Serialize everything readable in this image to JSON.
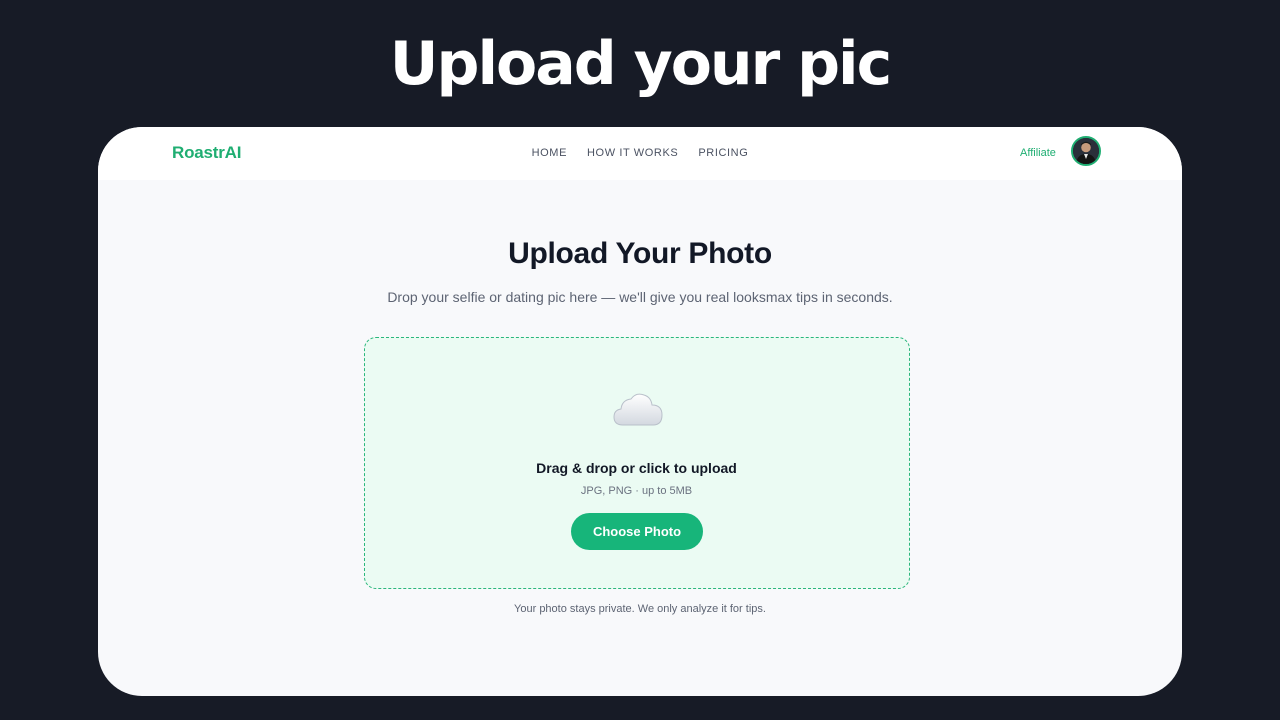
{
  "hero": {
    "title": "Upload your pic"
  },
  "navbar": {
    "brand": "RoastrAI",
    "links": [
      "HOME",
      "HOW IT WORKS",
      "PRICING"
    ],
    "affiliate": "Affiliate"
  },
  "main": {
    "title": "Upload Your Photo",
    "subtitle": "Drop your selfie or dating pic here — we'll give you real looksmax tips in seconds.",
    "dropzone": {
      "icon": "cloud-icon",
      "title": "Drag & drop or click to upload",
      "hint": "JPG, PNG · up to 5MB",
      "button_label": "Choose Photo"
    },
    "privacy_note": "Your photo stays private. We only analyze it for tips."
  },
  "colors": {
    "background": "#171b26",
    "accent": "#17b57a",
    "dropzone_bg": "#ebfbf3",
    "title_text": "#121826"
  }
}
